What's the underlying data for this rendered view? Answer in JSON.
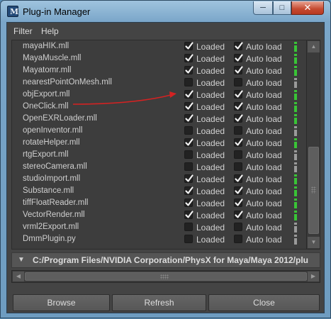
{
  "window": {
    "title": "Plug-in Manager",
    "icon": "maya-app-icon",
    "controls": {
      "minimize": "minimize-icon",
      "maximize": "maximize-icon",
      "close": "close-icon"
    }
  },
  "menu": [
    "Filter",
    "Help"
  ],
  "checkbox_labels": {
    "loaded": "Loaded",
    "auto_load": "Auto load"
  },
  "plugins": [
    {
      "name": "mayaHIK.mll",
      "loaded": true,
      "auto_load": true
    },
    {
      "name": "MayaMuscle.mll",
      "loaded": true,
      "auto_load": true
    },
    {
      "name": "Mayatomr.mll",
      "loaded": true,
      "auto_load": true
    },
    {
      "name": "nearestPointOnMesh.mll",
      "loaded": false,
      "auto_load": false
    },
    {
      "name": "objExport.mll",
      "loaded": true,
      "auto_load": true
    },
    {
      "name": "OneClick.mll",
      "loaded": true,
      "auto_load": true
    },
    {
      "name": "OpenEXRLoader.mll",
      "loaded": true,
      "auto_load": true
    },
    {
      "name": "openInventor.mll",
      "loaded": false,
      "auto_load": false
    },
    {
      "name": "rotateHelper.mll",
      "loaded": true,
      "auto_load": true
    },
    {
      "name": "rtgExport.mll",
      "loaded": false,
      "auto_load": false
    },
    {
      "name": "stereoCamera.mll",
      "loaded": false,
      "auto_load": false
    },
    {
      "name": "studioImport.mll",
      "loaded": true,
      "auto_load": true
    },
    {
      "name": "Substance.mll",
      "loaded": true,
      "auto_load": true
    },
    {
      "name": "tiffFloatReader.mll",
      "loaded": true,
      "auto_load": true
    },
    {
      "name": "VectorRender.mll",
      "loaded": true,
      "auto_load": true
    },
    {
      "name": "vrml2Export.mll",
      "loaded": false,
      "auto_load": false
    },
    {
      "name": "DmmPlugin.py",
      "loaded": false,
      "auto_load": false
    }
  ],
  "path_section": {
    "text": "C:/Program Files/NVIDIA Corporation/PhysX for Maya/Maya 2012/plu"
  },
  "buttons": {
    "browse": "Browse",
    "refresh": "Refresh",
    "close": "Close"
  },
  "colors": {
    "info_active": "#39c436",
    "info_inactive": "#9a9a9a",
    "annotation_arrow": "#d42222",
    "panel_bg": "#444444"
  }
}
